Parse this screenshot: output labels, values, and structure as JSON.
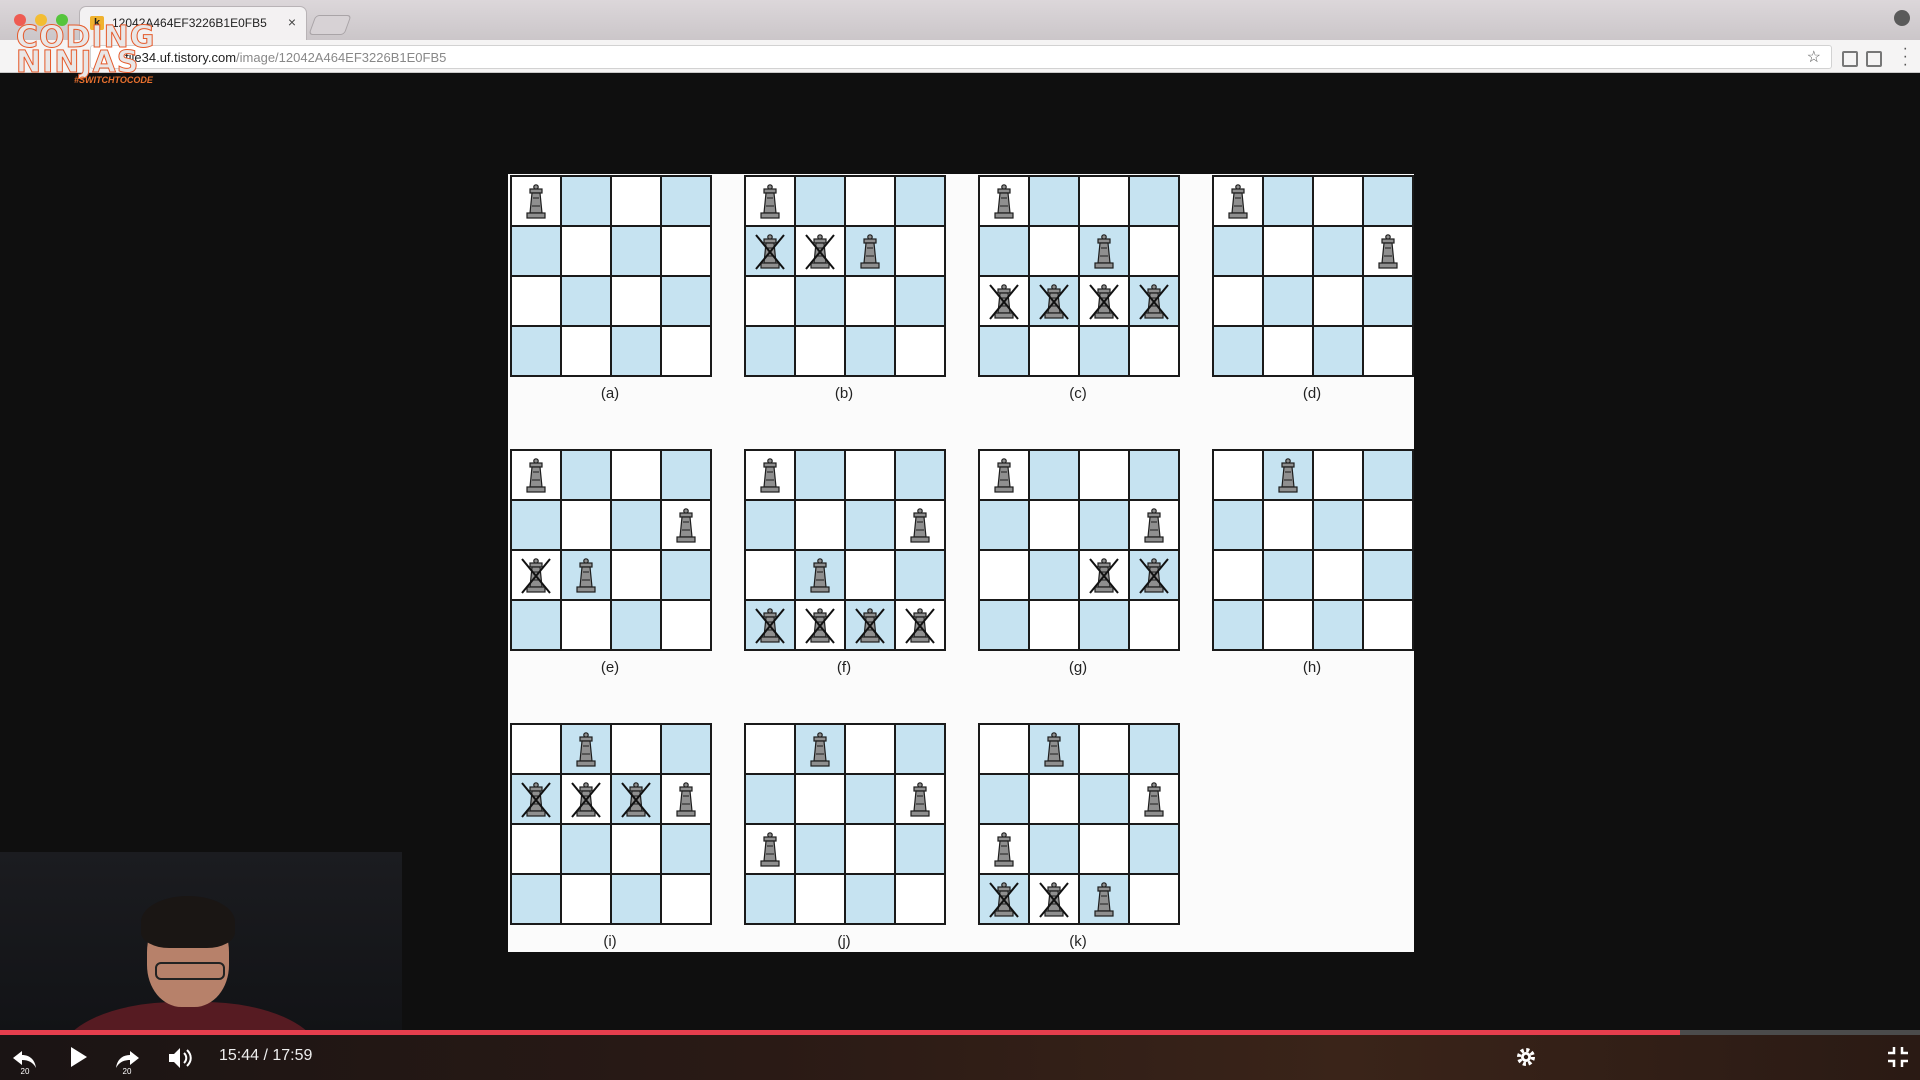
{
  "browser": {
    "tab_title": "12042A464EF3226B1E0FB5",
    "tab_favicon": "k",
    "url_host": "file34.uf.tistory.com",
    "url_path": "/image/12042A464EF3226B1E0FB5"
  },
  "logo": {
    "line1": "CODING",
    "line2": "NINJAS",
    "tagline": "#SWITCHTOCODE"
  },
  "figure": {
    "light_square_color": "#ffffff",
    "dark_square_color": "#c6e3f1",
    "piece_icon": "queen-piece-icon",
    "crossed_piece_icon": "crossed-queen-icon",
    "boards": [
      {
        "label": "(a)",
        "queens": [
          [
            0,
            0
          ]
        ],
        "crossed": []
      },
      {
        "label": "(b)",
        "queens": [
          [
            0,
            0
          ],
          [
            1,
            2
          ]
        ],
        "crossed": [
          [
            1,
            0
          ],
          [
            1,
            1
          ]
        ]
      },
      {
        "label": "(c)",
        "queens": [
          [
            0,
            0
          ],
          [
            1,
            2
          ]
        ],
        "crossed": [
          [
            2,
            0
          ],
          [
            2,
            1
          ],
          [
            2,
            2
          ],
          [
            2,
            3
          ]
        ]
      },
      {
        "label": "(d)",
        "queens": [
          [
            0,
            0
          ],
          [
            1,
            3
          ]
        ],
        "crossed": []
      },
      {
        "label": "(e)",
        "queens": [
          [
            0,
            0
          ],
          [
            1,
            3
          ],
          [
            2,
            1
          ]
        ],
        "crossed": [
          [
            2,
            0
          ]
        ]
      },
      {
        "label": "(f)",
        "queens": [
          [
            0,
            0
          ],
          [
            1,
            3
          ],
          [
            2,
            1
          ]
        ],
        "crossed": [
          [
            3,
            0
          ],
          [
            3,
            1
          ],
          [
            3,
            2
          ],
          [
            3,
            3
          ]
        ]
      },
      {
        "label": "(g)",
        "queens": [
          [
            0,
            0
          ],
          [
            1,
            3
          ]
        ],
        "crossed": [
          [
            2,
            2
          ],
          [
            2,
            3
          ]
        ]
      },
      {
        "label": "(h)",
        "queens": [
          [
            0,
            1
          ]
        ],
        "crossed": []
      },
      {
        "label": "(i)",
        "queens": [
          [
            0,
            1
          ],
          [
            1,
            3
          ]
        ],
        "crossed": [
          [
            1,
            0
          ],
          [
            1,
            1
          ],
          [
            1,
            2
          ]
        ]
      },
      {
        "label": "(j)",
        "queens": [
          [
            0,
            1
          ],
          [
            1,
            3
          ],
          [
            2,
            0
          ]
        ],
        "crossed": []
      },
      {
        "label": "(k)",
        "queens": [
          [
            0,
            1
          ],
          [
            1,
            3
          ],
          [
            2,
            0
          ],
          [
            3,
            2
          ]
        ],
        "crossed": [
          [
            3,
            0
          ],
          [
            3,
            1
          ]
        ]
      }
    ]
  },
  "player": {
    "current_time": "15:44",
    "duration": "17:59",
    "time_display": "15:44 / 17:59",
    "progress_fraction": 0.875,
    "skip_seconds": "20",
    "accent_color": "#e53e4d"
  }
}
